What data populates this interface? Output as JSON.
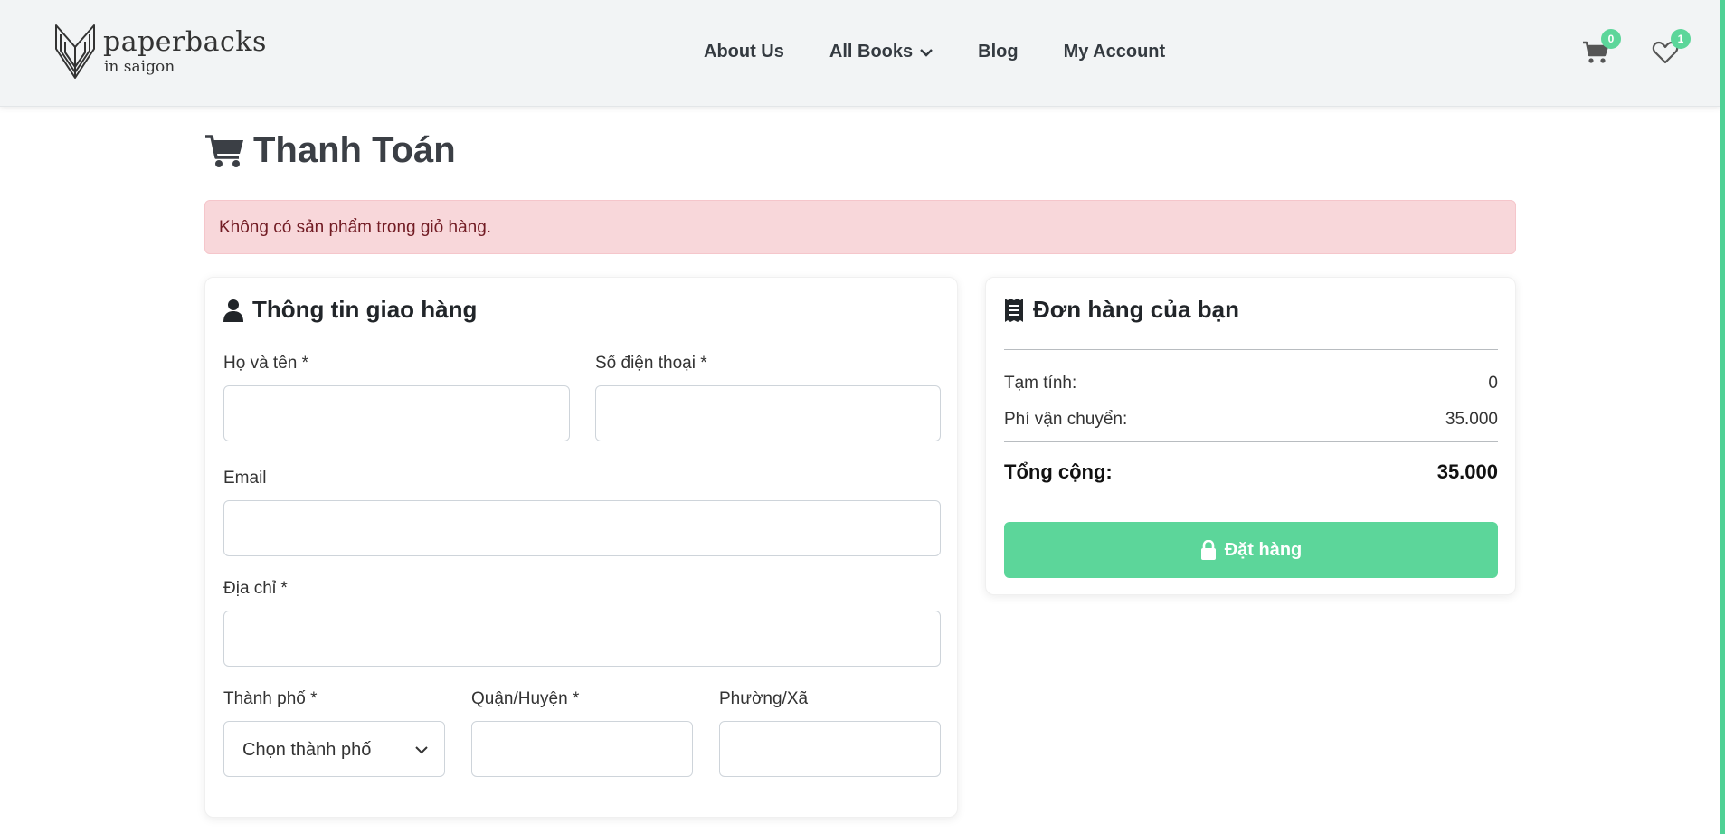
{
  "brand": {
    "name": "paperbacks",
    "tagline": "in saigon"
  },
  "nav": {
    "items": [
      {
        "label": "About Us"
      },
      {
        "label": "All Books",
        "has_dropdown": true
      },
      {
        "label": "Blog"
      },
      {
        "label": "My Account"
      }
    ],
    "cart_count": "0",
    "wishlist_count": "1"
  },
  "page": {
    "title": "Thanh Toán",
    "alert": "Không có sản phẩm trong giỏ hàng."
  },
  "shipping": {
    "title": "Thông tin giao hàng",
    "fields": {
      "name_label": "Họ và tên *",
      "phone_label": "Số điện thoại *",
      "email_label": "Email",
      "address_label": "Địa chỉ *",
      "city_label": "Thành phố *",
      "city_selected": "Chọn thành phố",
      "district_label": "Quận/Huyện *",
      "ward_label": "Phường/Xã"
    }
  },
  "order": {
    "title": "Đơn hàng của bạn",
    "subtotal_label": "Tạm tính:",
    "subtotal_value": "0",
    "shipping_label": "Phí vận chuyển:",
    "shipping_value": "35.000",
    "total_label": "Tổng cộng:",
    "total_value": "35.000",
    "button_label": "Đặt hàng"
  },
  "colors": {
    "accent": "#5cd69a",
    "alert_bg": "#f8d7da",
    "alert_text": "#721c24",
    "header_bg": "#f2f4f5"
  },
  "icons": {
    "logo": "book-pages-icon",
    "cart": "shopping-cart-icon",
    "wishlist": "heart-icon",
    "user": "user-icon",
    "receipt": "receipt-icon",
    "lock": "lock-icon"
  }
}
